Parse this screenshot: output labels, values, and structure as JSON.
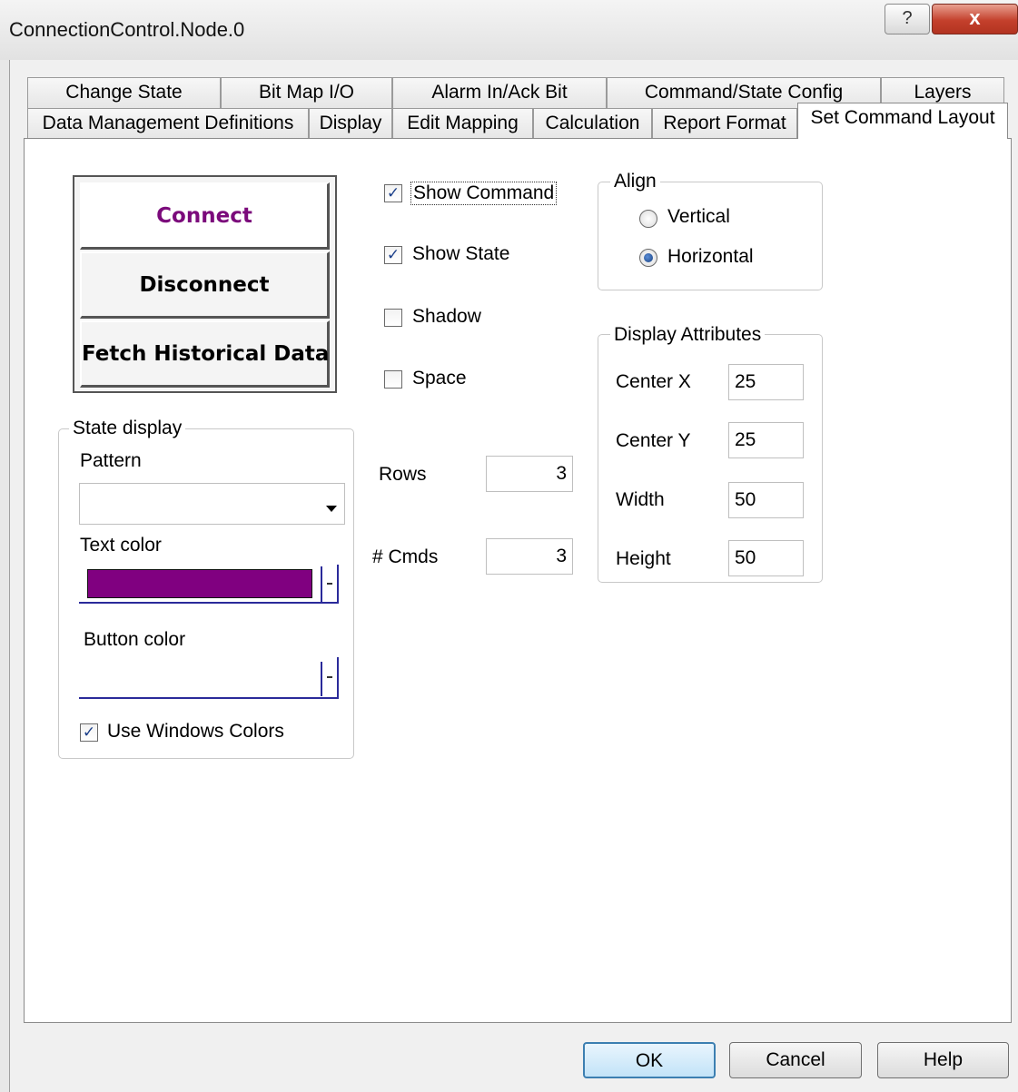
{
  "window": {
    "title": "ConnectionControl.Node.0",
    "help_glyph": "?",
    "close_glyph": "x"
  },
  "tabs": {
    "row1": [
      "Change State",
      "Bit Map I/O",
      "Alarm In/Ack Bit",
      "Command/State Config",
      "Layers"
    ],
    "row2": [
      "Data Management Definitions",
      "Display",
      "Edit Mapping",
      "Calculation",
      "Report Format",
      "Set Command Layout"
    ],
    "active": "Set Command Layout"
  },
  "preview": {
    "buttons": [
      "Connect",
      "Disconnect",
      "Fetch Historical Data"
    ]
  },
  "options": {
    "show_command": {
      "label": "Show Command",
      "checked": true
    },
    "show_state": {
      "label": "Show State",
      "checked": true
    },
    "shadow": {
      "label": "Shadow",
      "checked": false
    },
    "space": {
      "label": "Space",
      "checked": false
    },
    "check_glyph": "✓"
  },
  "counts": {
    "rows_label": "Rows",
    "rows_value": "3",
    "cmds_label": "# Cmds",
    "cmds_value": "3"
  },
  "align": {
    "legend": "Align",
    "vertical": {
      "label": "Vertical",
      "selected": false
    },
    "horizontal": {
      "label": "Horizontal",
      "selected": true
    }
  },
  "display_attributes": {
    "legend": "Display Attributes",
    "center_x_label": "Center X",
    "center_x": "25",
    "center_y_label": "Center Y",
    "center_y": "25",
    "width_label": "Width",
    "width": "50",
    "height_label": "Height",
    "height": "50"
  },
  "state_display": {
    "legend": "State display",
    "pattern_label": "Pattern",
    "pattern_value": "",
    "text_color_label": "Text color",
    "button_color_label": "Button color",
    "use_windows_colors": {
      "label": "Use Windows Colors",
      "checked": true
    }
  },
  "footer": {
    "ok": "OK",
    "cancel": "Cancel",
    "help": "Help"
  },
  "colors": {
    "connect_text": "#7b0a7b",
    "text_color_swatch": "#800080",
    "accent_blue": "#3c7fb1"
  }
}
